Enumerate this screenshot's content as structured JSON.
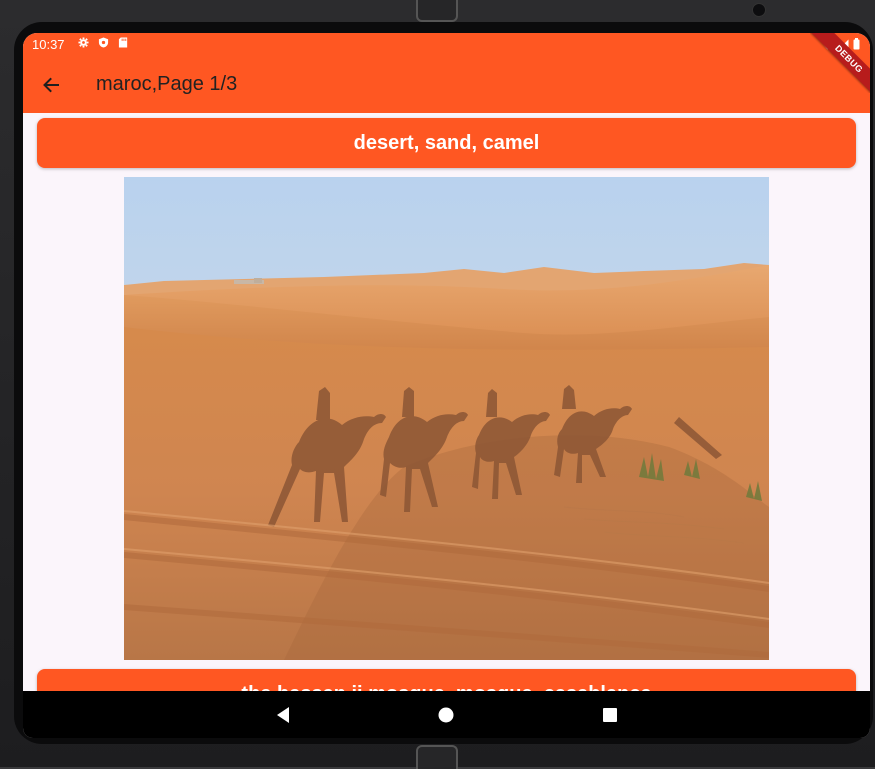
{
  "status_bar": {
    "time": "10:37",
    "icons": [
      "settings-icon",
      "shield-icon",
      "sd-card-icon"
    ],
    "right_icons": [
      "wifi-icon",
      "signal-icon",
      "battery-icon"
    ]
  },
  "app_bar": {
    "title": "maroc,Page 1/3",
    "back_icon": "arrow-back-icon",
    "debug_label": "DEBUG"
  },
  "content": {
    "banner_1": "desert, sand, camel",
    "banner_2": "the hassan ii mosque, mosque, casablanca",
    "image_alt": "Shadows of camel riders on desert sand dunes"
  },
  "nav_bar": {
    "buttons": [
      "back-triangle-icon",
      "home-circle-icon",
      "recents-square-icon"
    ]
  },
  "colors": {
    "primary": "#ff5722",
    "background": "#fbf5fb",
    "ribbon": "#b71c1c"
  }
}
